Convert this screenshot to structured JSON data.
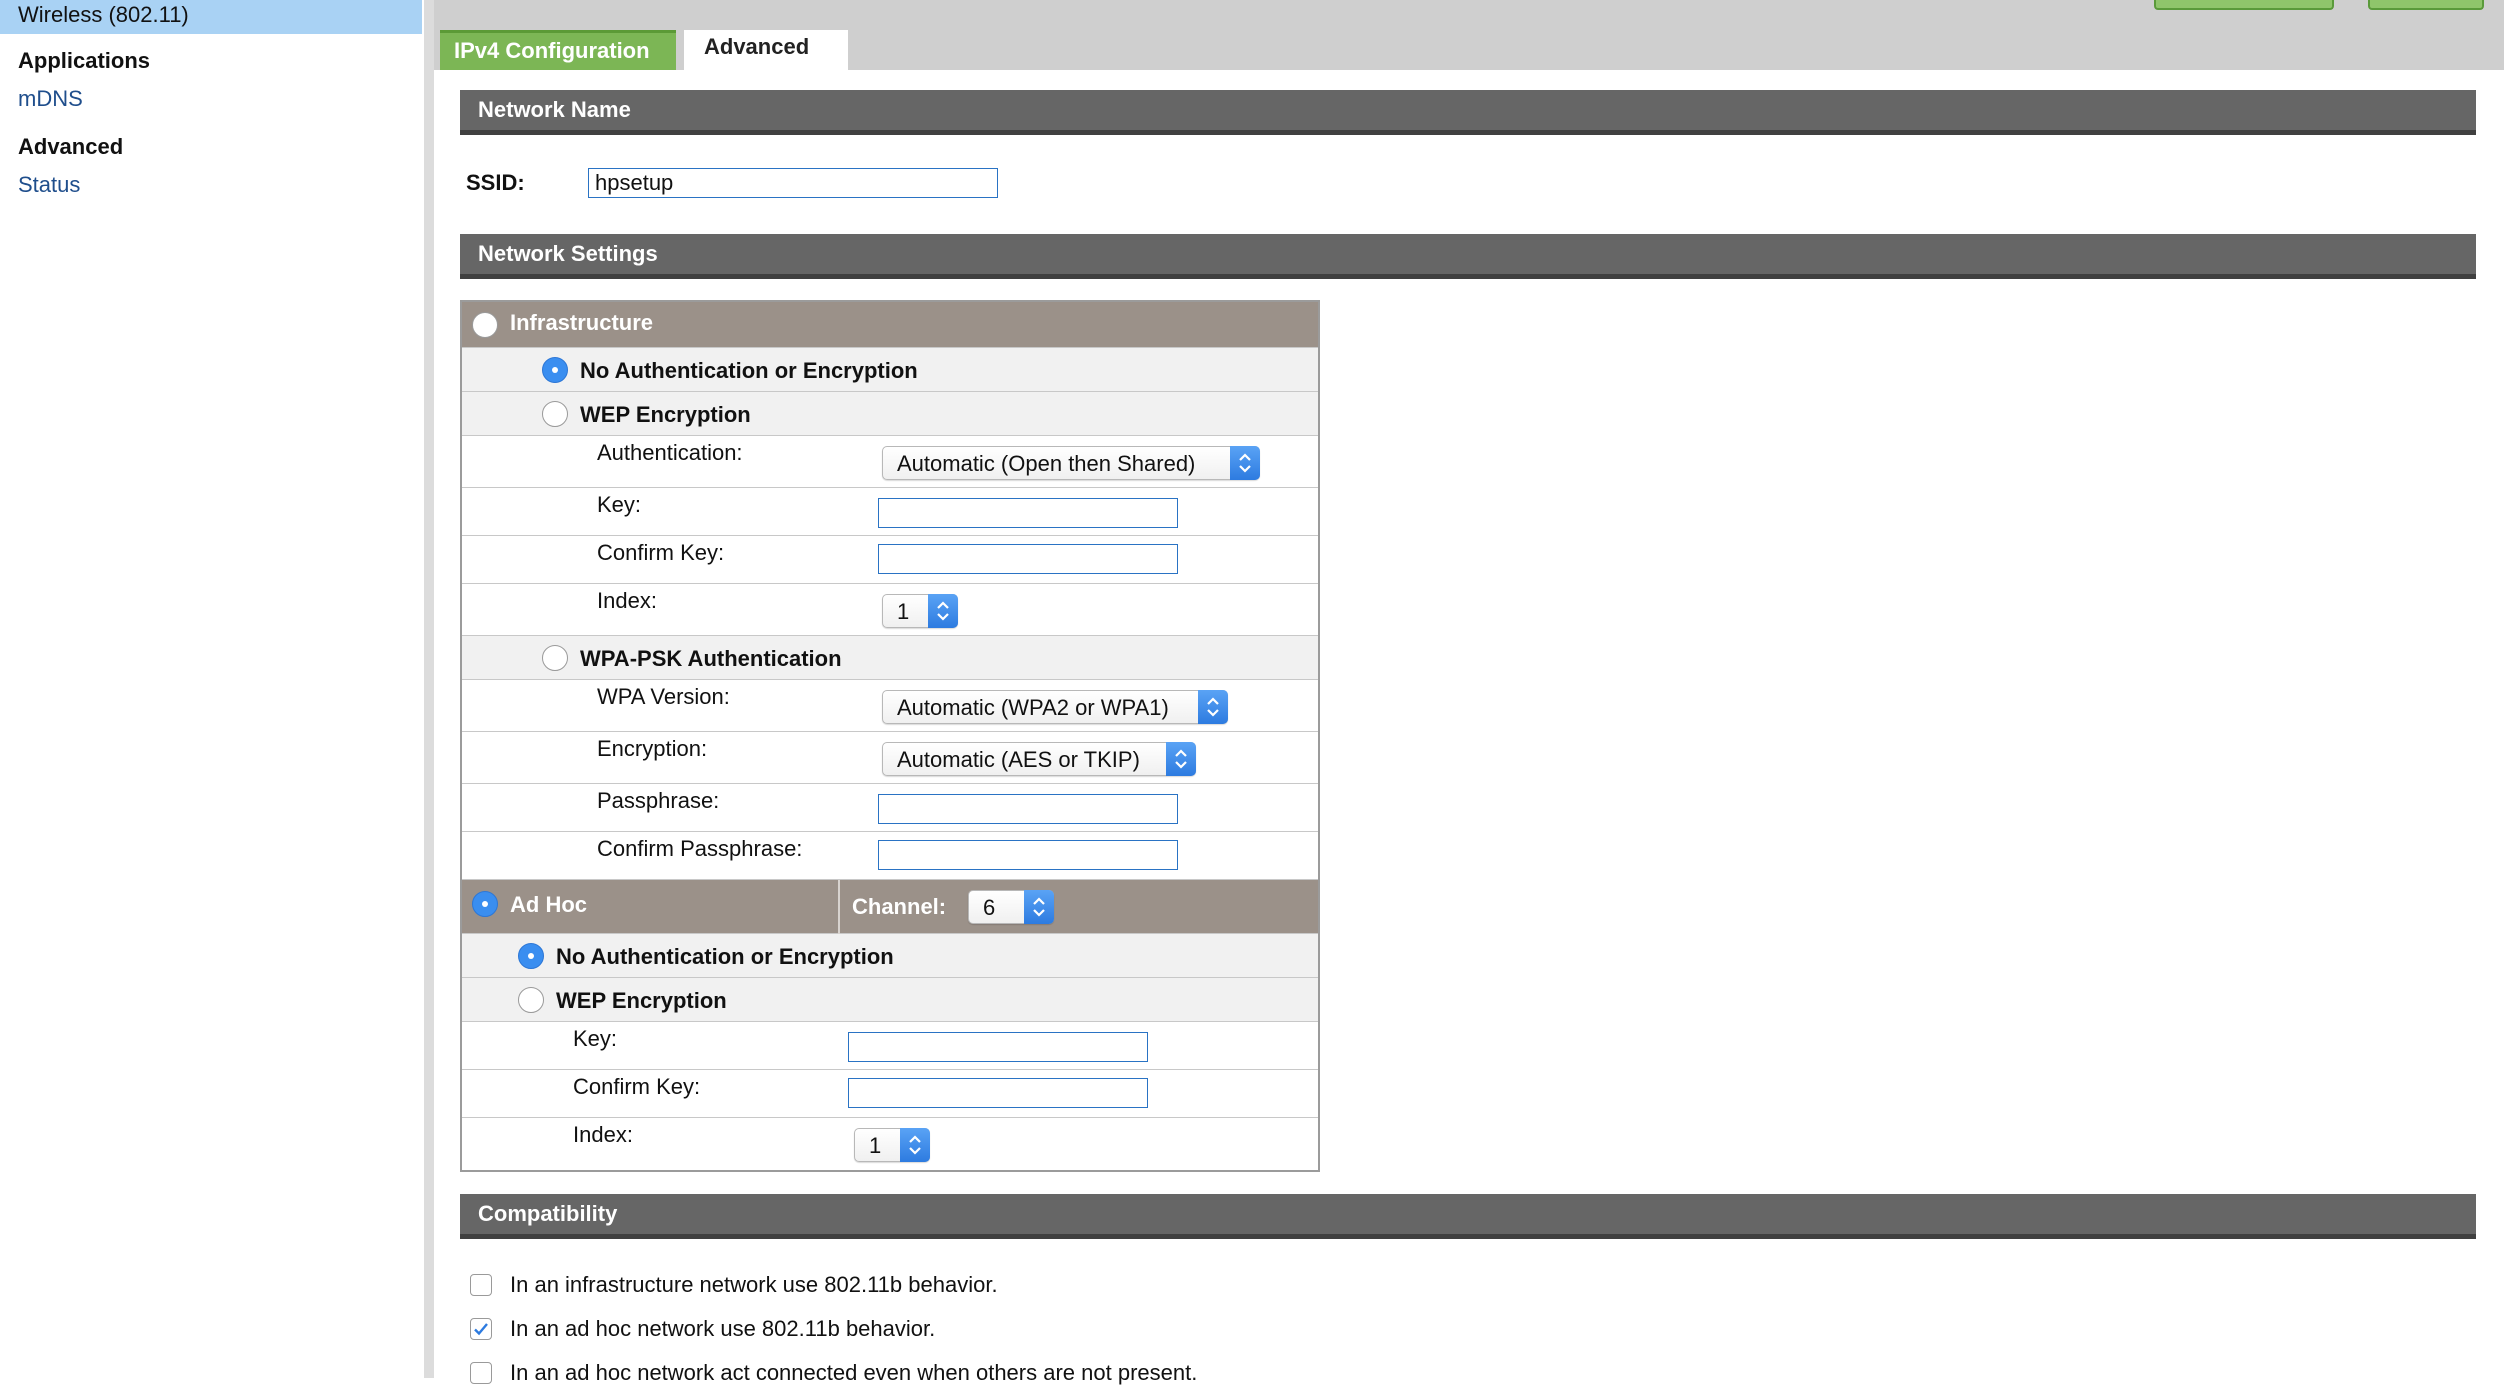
{
  "sidebar": {
    "selected_item": "Wireless (802.11)",
    "groups": [
      {
        "heading": "Applications",
        "links": [
          "mDNS"
        ]
      },
      {
        "heading": "Advanced",
        "links": [
          "Status"
        ]
      }
    ]
  },
  "tabs": [
    {
      "label": "IPv4 Configuration",
      "active": false
    },
    {
      "label": "Advanced",
      "active": true
    }
  ],
  "network_name": {
    "section_title": "Network Name",
    "ssid_label": "SSID:",
    "ssid_value": "hpsetup"
  },
  "network_settings": {
    "section_title": "Network Settings",
    "infrastructure": {
      "label": "Infrastructure",
      "selected": false,
      "no_auth_label": "No Authentication or Encryption",
      "wep": {
        "label": "WEP Encryption",
        "authentication_label": "Authentication:",
        "authentication_value": "Automatic (Open then Shared)",
        "key_label": "Key:",
        "confirm_key_label": "Confirm Key:",
        "index_label": "Index:",
        "index_value": "1"
      },
      "wpa": {
        "label": "WPA-PSK Authentication",
        "version_label": "WPA Version:",
        "version_value": "Automatic (WPA2 or WPA1)",
        "encryption_label": "Encryption:",
        "encryption_value": "Automatic (AES or TKIP)",
        "passphrase_label": "Passphrase:",
        "confirm_passphrase_label": "Confirm Passphrase:"
      }
    },
    "adhoc": {
      "label": "Ad Hoc",
      "selected": true,
      "channel_label": "Channel:",
      "channel_value": "6",
      "no_auth_label": "No Authentication or Encryption",
      "wep": {
        "label": "WEP Encryption",
        "key_label": "Key:",
        "confirm_key_label": "Confirm Key:",
        "index_label": "Index:",
        "index_value": "1"
      }
    }
  },
  "compatibility": {
    "section_title": "Compatibility",
    "options": [
      {
        "label": "In an infrastructure network use 802.11b behavior.",
        "checked": false
      },
      {
        "label": "In an ad hoc network use 802.11b behavior.",
        "checked": true
      },
      {
        "label": "In an ad hoc network act connected even when others are not present.",
        "checked": false
      }
    ]
  },
  "colors": {
    "tab_active_green": "#7cb655",
    "section_header": "#666666",
    "table_header": "#9b9189",
    "accent_blue": "#3a8ef0"
  }
}
